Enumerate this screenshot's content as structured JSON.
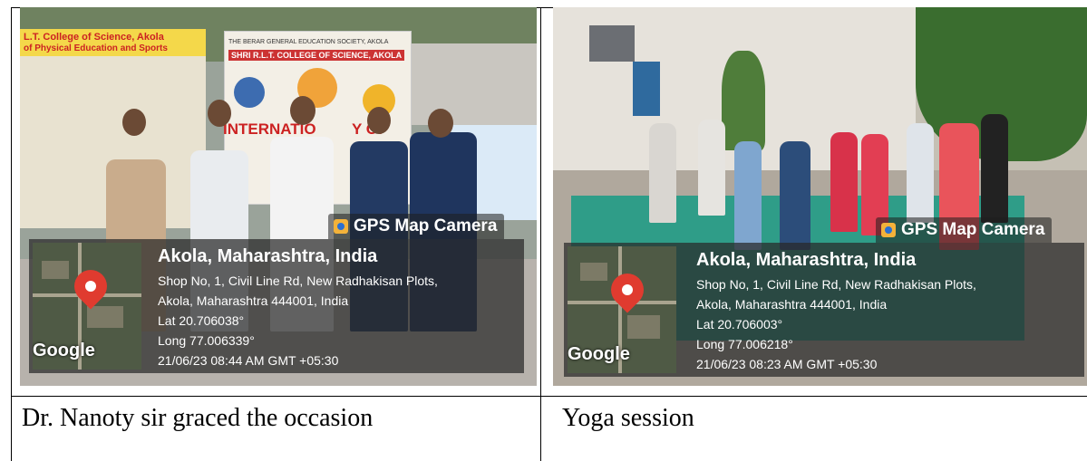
{
  "cells": [
    {
      "gps_badge": "GPS Map Camera",
      "city": "Akola, Maharashtra, India",
      "address_line1": "Shop No, 1, Civil Line Rd, New Radhakisan Plots,",
      "address_line2": "Akola, Maharashtra 444001, India",
      "lat": "Lat 20.706038°",
      "long": "Long 77.006339°",
      "timestamp": "21/06/23 08:44 AM GMT +05:30",
      "map_logo": "Google",
      "caption": "Dr. Nanoty sir graced the occasion",
      "banner_left": "L.T. College of Science, Akola",
      "banner_left_sub": "of Physical Education and Sports",
      "banner_center1": "THE BERAR GENERAL EDUCATION SOCIETY, AKOLA",
      "banner_center2": "SHRI R.L.T. COLLEGE OF SCIENCE, AKOLA",
      "banner_center3": "INTERNATIO",
      "banner_center4": "Y OF"
    },
    {
      "gps_badge": "GPS Map Camera",
      "city": "Akola, Maharashtra, India",
      "address_line1": "Shop No, 1, Civil Line Rd, New Radhakisan Plots,",
      "address_line2": "Akola, Maharashtra 444001, India",
      "lat": "Lat 20.706003°",
      "long": "Long 77.006218°",
      "timestamp": "21/06/23 08:23 AM GMT +05:30",
      "map_logo": "Google",
      "caption": "Yoga session"
    }
  ]
}
